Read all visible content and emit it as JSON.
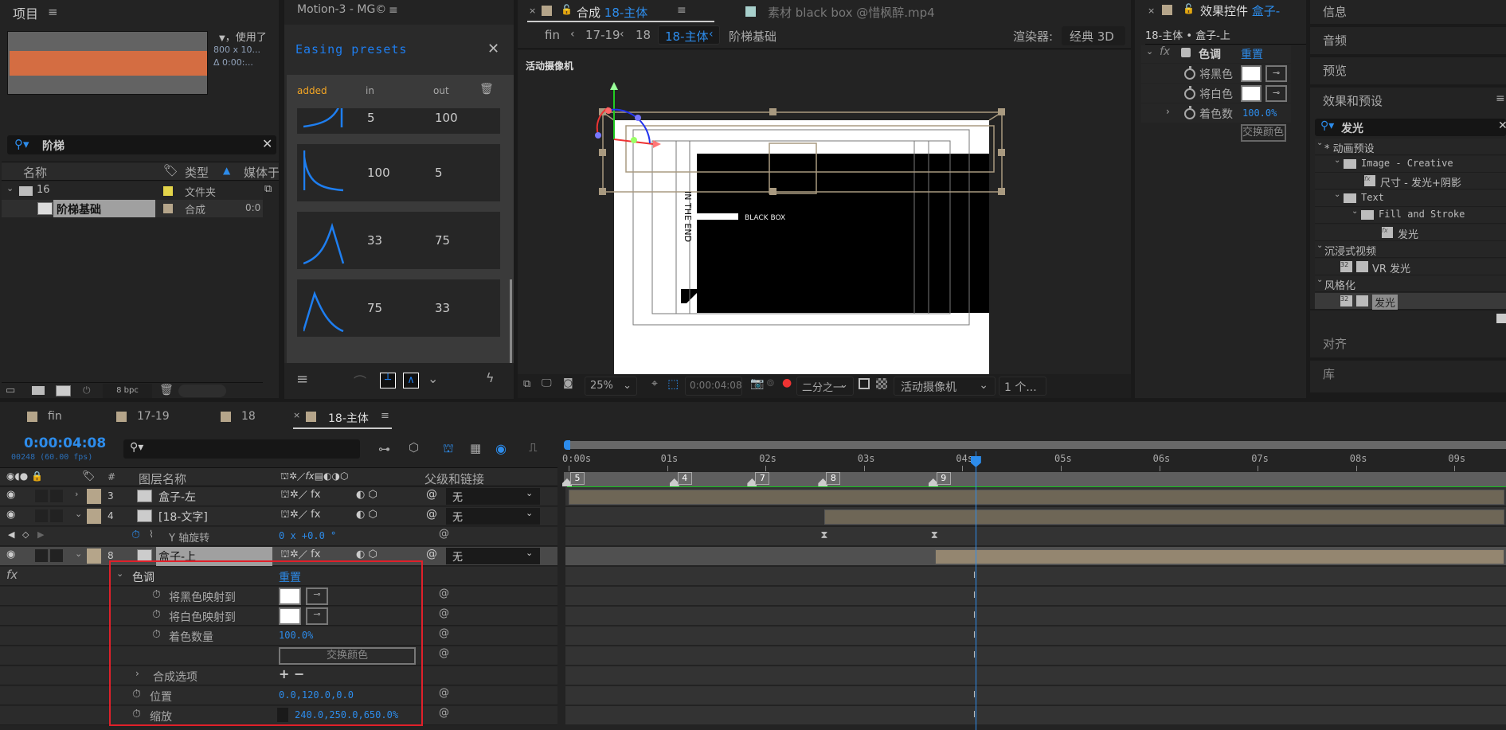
{
  "project": {
    "title": "项目",
    "info_line1": "，使用了",
    "info_line2": "800 x 10...",
    "info_line3": "Δ 0:00:...",
    "search_value": "阶梯",
    "columns": {
      "name": "名称",
      "type": "类型",
      "media": "媒体于"
    },
    "items": [
      {
        "name": "16",
        "type": "文件夹",
        "color": "#e3d44a",
        "kind": "folder"
      },
      {
        "name": "阶梯基础",
        "type": "合成",
        "duration": "0:0",
        "color": "#b5a58a",
        "kind": "comp"
      }
    ],
    "bpc": "8 bpc"
  },
  "motion": {
    "title": "Motion-3 - MG©",
    "section": "Easing presets",
    "col_added": "added",
    "col_in": "in",
    "col_out": "out",
    "presets": [
      {
        "in": "5",
        "out": "100"
      },
      {
        "in": "100",
        "out": "5"
      },
      {
        "in": "33",
        "out": "75"
      },
      {
        "in": "75",
        "out": "33"
      }
    ]
  },
  "comp": {
    "tab_prefix": "合成",
    "tab_name": "18-主体",
    "footage_tab": "素材 black box @惜枫醉.mp4",
    "breadcrumbs": [
      "fin",
      "17-19",
      "18",
      "18-主体",
      "阶梯基础"
    ],
    "renderer_label": "渲染器:",
    "renderer_value": "经典 3D",
    "camera_label": "活动摄像机",
    "text_vertical": "IN THE END",
    "text_box": "BLACK BOX",
    "toolbar": {
      "zoom": "25%",
      "timecode": "0:00:04:08",
      "resolution": "二分之一",
      "view": "活动摄像机",
      "views_count": "1 个..."
    }
  },
  "effect_controls": {
    "tab_title": "效果控件",
    "tab_layer": "盒子-",
    "header": "18-主体 • 盒子-上",
    "effect_name": "色调",
    "reset": "重置",
    "props": [
      {
        "label": "将黑色",
        "type": "color"
      },
      {
        "label": "将白色",
        "type": "color"
      },
      {
        "label": "着色数",
        "value": "100.0%"
      }
    ],
    "swap_button": "交换颜色"
  },
  "right_panels": {
    "info": "信息",
    "audio": "音频",
    "preview": "预览",
    "effects_presets": "效果和预设",
    "search_value": "发光",
    "tree": [
      {
        "label": "* 动画预设",
        "level": 0,
        "kind": "group"
      },
      {
        "label": "Image - Creative",
        "level": 1,
        "kind": "folder"
      },
      {
        "label": "尺寸 - 发光+阴影",
        "level": 2,
        "kind": "preset"
      },
      {
        "label": "Text",
        "level": 1,
        "kind": "folder"
      },
      {
        "label": "Fill and Stroke",
        "level": 2,
        "kind": "folder"
      },
      {
        "label": "发光",
        "level": 3,
        "kind": "preset"
      },
      {
        "label": "沉浸式视频",
        "level": 0,
        "kind": "group"
      },
      {
        "label": "VR 发光",
        "level": 1,
        "kind": "effect"
      },
      {
        "label": "风格化",
        "level": 0,
        "kind": "group"
      },
      {
        "label": "发光",
        "level": 1,
        "kind": "effect",
        "selected": true
      }
    ],
    "align": "对齐",
    "library": "库"
  },
  "timeline": {
    "tabs": [
      "fin",
      "17-19",
      "18",
      "18-主体"
    ],
    "active_tab": "18-主体",
    "timecode": "0:00:04:08",
    "frame_info": "00248 (60.00 fps)",
    "col_layer_name": "图层名称",
    "col_parent": "父级和链接",
    "ruler": [
      "0:00s",
      "01s",
      "02s",
      "03s",
      "04s",
      "05s",
      "06s",
      "07s",
      "08s",
      "09s"
    ],
    "markers": [
      "5",
      "4",
      "7",
      "8",
      "9"
    ],
    "playhead_seconds": 4.133,
    "layers": [
      {
        "num": "3",
        "name": "盒子-左",
        "parent": "无"
      },
      {
        "num": "4",
        "name": "[18-文字]",
        "parent": "无"
      },
      {
        "num": "8",
        "name": "盒子-上",
        "parent": "无",
        "selected": true
      }
    ],
    "rotation_prop": {
      "label": "Y 轴旋转",
      "value": "0 x +0.0 °"
    },
    "effect": {
      "name": "色调",
      "reset": "重置",
      "props": [
        {
          "label": "将黑色映射到",
          "type": "color"
        },
        {
          "label": "将白色映射到",
          "type": "color"
        },
        {
          "label": "着色数量",
          "value": "100.0%"
        }
      ],
      "swap_button": "交换颜色",
      "comp_options": "合成选项",
      "comp_options_value": "+ −"
    },
    "position": {
      "label": "位置",
      "value": "0.0,120.0,0.0"
    },
    "scale": {
      "label": "缩放",
      "value": "240.0,250.0,650.0%"
    }
  }
}
